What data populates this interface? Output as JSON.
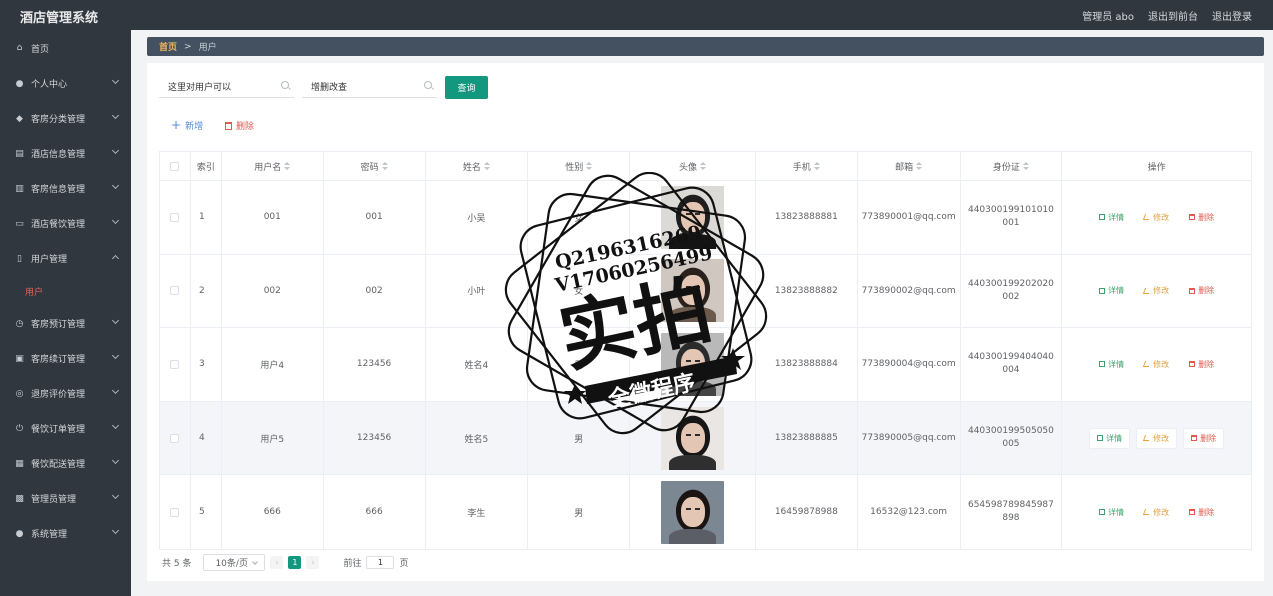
{
  "app": {
    "title": "酒店管理系统",
    "user_label": "管理员 abo",
    "to_front": "退出到前台",
    "logout": "退出登录"
  },
  "sidebar": {
    "items": [
      {
        "label": "首页",
        "icon": "home-icon",
        "glyph": "⌂",
        "chev": "none"
      },
      {
        "label": "个人中心",
        "icon": "person-icon",
        "glyph": "●",
        "chev": "down"
      },
      {
        "label": "客房分类管理",
        "icon": "location-icon",
        "glyph": "◆",
        "chev": "down"
      },
      {
        "label": "酒店信息管理",
        "icon": "document-icon",
        "glyph": "▤",
        "chev": "down"
      },
      {
        "label": "客房信息管理",
        "icon": "bar-chart-icon",
        "glyph": "▥",
        "chev": "down"
      },
      {
        "label": "酒店餐饮管理",
        "icon": "chat-icon",
        "glyph": "▭",
        "chev": "down"
      },
      {
        "label": "用户管理",
        "icon": "phone-icon",
        "glyph": "▯",
        "chev": "up"
      },
      {
        "label": "客房预订管理",
        "icon": "clock-icon",
        "glyph": "◷",
        "chev": "down"
      },
      {
        "label": "客房续订管理",
        "icon": "briefcase-icon",
        "glyph": "▣",
        "chev": "down"
      },
      {
        "label": "退房评价管理",
        "icon": "globe-icon",
        "glyph": "◎",
        "chev": "down"
      },
      {
        "label": "餐饮订单管理",
        "icon": "power-icon",
        "glyph": "⏻",
        "chev": "down"
      },
      {
        "label": "餐饮配送管理",
        "icon": "stats-icon",
        "glyph": "▦",
        "chev": "down"
      },
      {
        "label": "管理员管理",
        "icon": "grid-icon",
        "glyph": "▩",
        "chev": "down"
      },
      {
        "label": "系统管理",
        "icon": "user-icon",
        "glyph": "●",
        "chev": "down"
      }
    ],
    "active_sub": "用户"
  },
  "breadcrumb": {
    "home": "首页",
    "sep": ">",
    "current": "用户"
  },
  "search": {
    "field1": "这里对用户可以",
    "field2": "增删改查",
    "query_button": "查询"
  },
  "actions": {
    "add": "新增",
    "delete": "删除"
  },
  "table": {
    "columns": [
      "索引",
      "用户名",
      "密码",
      "姓名",
      "性别",
      "头像",
      "手机",
      "邮箱",
      "身份证",
      "操作"
    ],
    "rows": [
      {
        "index": "1",
        "username": "001",
        "password": "001",
        "name": "小吴",
        "gender": "女",
        "phone": "13823888881",
        "email": "773890001@qq.com",
        "idcard": "440300199101010001",
        "avatar": {
          "hair": "#1e1e1e",
          "bg": "#dcdad7",
          "shirt": "#141414"
        }
      },
      {
        "index": "2",
        "username": "002",
        "password": "002",
        "name": "小叶",
        "gender": "女",
        "phone": "13823888882",
        "email": "773890002@qq.com",
        "idcard": "440300199202020002",
        "avatar": {
          "hair": "#2a211c",
          "bg": "#cfc7c0",
          "shirt": "#6c5a4c"
        }
      },
      {
        "index": "3",
        "username": "用户4",
        "password": "123456",
        "name": "姓名4",
        "gender": "男",
        "phone": "13823888884",
        "email": "773890004@qq.com",
        "idcard": "440300199404040004",
        "avatar": {
          "hair": "#2b2b2b",
          "bg": "#b9b9b9",
          "shirt": "#444444"
        }
      },
      {
        "index": "4",
        "username": "用户5",
        "password": "123456",
        "name": "姓名5",
        "gender": "男",
        "phone": "13823888885",
        "email": "773890005@qq.com",
        "idcard": "440300199505050005",
        "avatar": {
          "hair": "#161616",
          "bg": "#e9e6e3",
          "shirt": "#2f2f2f"
        }
      },
      {
        "index": "5",
        "username": "666",
        "password": "666",
        "name": "李生",
        "gender": "男",
        "phone": "16459878988",
        "email": "16532@123.com",
        "idcard": "654598789845987898",
        "avatar": {
          "hair": "#1a1512",
          "bg": "#7c8794",
          "shirt": "#5b5e66"
        }
      }
    ],
    "op_detail": "详情",
    "op_edit": "修改",
    "op_delete": "删除",
    "hover_row": 4
  },
  "pagination": {
    "total": "共 5 条",
    "page_size": "10条/页",
    "current_page": "1",
    "goto_label": "前往",
    "goto_value": "1",
    "page_suffix": "页"
  },
  "watermark": {
    "line1": "Q2196316269",
    "line2": "V17060256499",
    "main": "实拍",
    "banner": "全微程序"
  },
  "colors": {
    "sidebar_bg": "#30373f",
    "accent_green": "#13977e",
    "active_sub": "#e3615a",
    "breadcrumb_bg": "#435161"
  }
}
